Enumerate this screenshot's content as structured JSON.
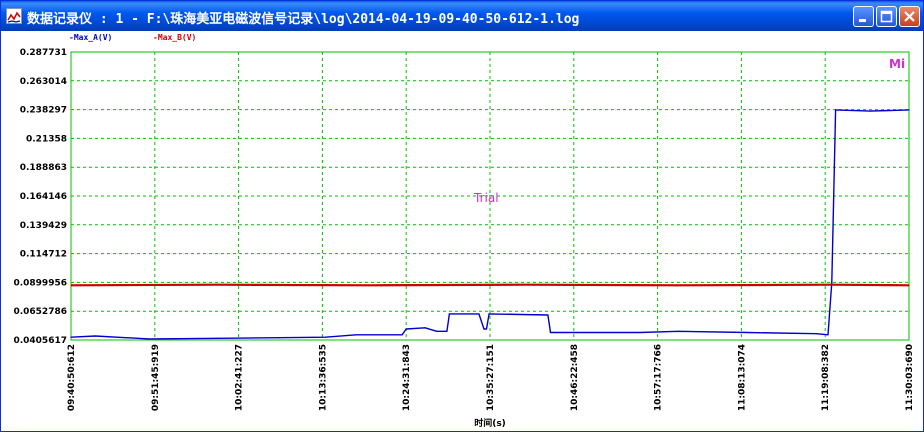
{
  "window": {
    "title": "数据记录仪 : 1 - F:\\珠海美亚电磁波信号记录\\log\\2014-04-19-09-40-50-612-1.log"
  },
  "legend": {
    "entries": [
      {
        "label": "-Max_A(V)",
        "color": "#0000cc"
      },
      {
        "label": "-Max_B(V)",
        "color": "#cc0000"
      }
    ]
  },
  "overlay": {
    "corner_mark": "Mi",
    "watermark": "Trial"
  },
  "chart_data": {
    "type": "line",
    "title": "",
    "xlabel": "时间(s)",
    "ylabel": "",
    "grid": true,
    "grid_color": "#00c000",
    "background": "#ffffff",
    "xlim": [
      "09:40:50:612",
      "11:30:03:690"
    ],
    "x_ticks": [
      "09:40:50:612",
      "09:51:45:919",
      "10:02:41:227",
      "10:13:36:535",
      "10:24:31:843",
      "10:35:27:151",
      "10:46:22:458",
      "10:57:17:766",
      "11:08:13:074",
      "11:19:08:382",
      "11:30:03:690"
    ],
    "ylim": [
      0.0405617,
      0.287731
    ],
    "y_ticks": [
      "0.287731",
      "0.263014",
      "0.238297",
      "0.21358",
      "0.188863",
      "0.164146",
      "0.139429",
      "0.114712",
      "0.0899956",
      "0.0652786",
      "0.0405617"
    ],
    "series": [
      {
        "name": "Max_A(V)",
        "color": "#0000cc",
        "points": [
          [
            "09:40:50:612",
            0.043
          ],
          [
            "09:44:00:000",
            0.044
          ],
          [
            "09:51:00:000",
            0.0415
          ],
          [
            "10:00:00:000",
            0.042
          ],
          [
            "10:08:00:000",
            0.0425
          ],
          [
            "10:14:00:000",
            0.043
          ],
          [
            "10:18:00:000",
            0.045
          ],
          [
            "10:24:00:000",
            0.045
          ],
          [
            "10:24:31:843",
            0.05
          ],
          [
            "10:27:00:000",
            0.051
          ],
          [
            "10:28:30:000",
            0.048
          ],
          [
            "10:29:50:000",
            0.048
          ],
          [
            "10:30:10:000",
            0.063
          ],
          [
            "10:34:00:000",
            0.063
          ],
          [
            "10:34:40:000",
            0.05
          ],
          [
            "10:35:00:000",
            0.05
          ],
          [
            "10:35:20:000",
            0.063
          ],
          [
            "10:43:00:000",
            0.062
          ],
          [
            "10:43:20:000",
            0.047
          ],
          [
            "10:55:00:000",
            0.047
          ],
          [
            "11:00:00:000",
            0.048
          ],
          [
            "11:09:00:000",
            0.047
          ],
          [
            "11:18:00:000",
            0.046
          ],
          [
            "11:19:30:000",
            0.045
          ],
          [
            "11:20:00:000",
            0.09
          ],
          [
            "11:20:30:000",
            0.238
          ],
          [
            "11:25:00:000",
            0.237
          ],
          [
            "11:30:03:690",
            0.238
          ]
        ]
      },
      {
        "name": "Max_B(V)",
        "color": "#cc0000",
        "points": [
          [
            "09:40:50:612",
            0.0875
          ],
          [
            "10:00:00:000",
            0.088
          ],
          [
            "10:20:00:000",
            0.0875
          ],
          [
            "10:40:00:000",
            0.088
          ],
          [
            "11:00:00:000",
            0.0875
          ],
          [
            "11:20:00:000",
            0.088
          ],
          [
            "11:30:03:690",
            0.0875
          ]
        ]
      }
    ]
  }
}
